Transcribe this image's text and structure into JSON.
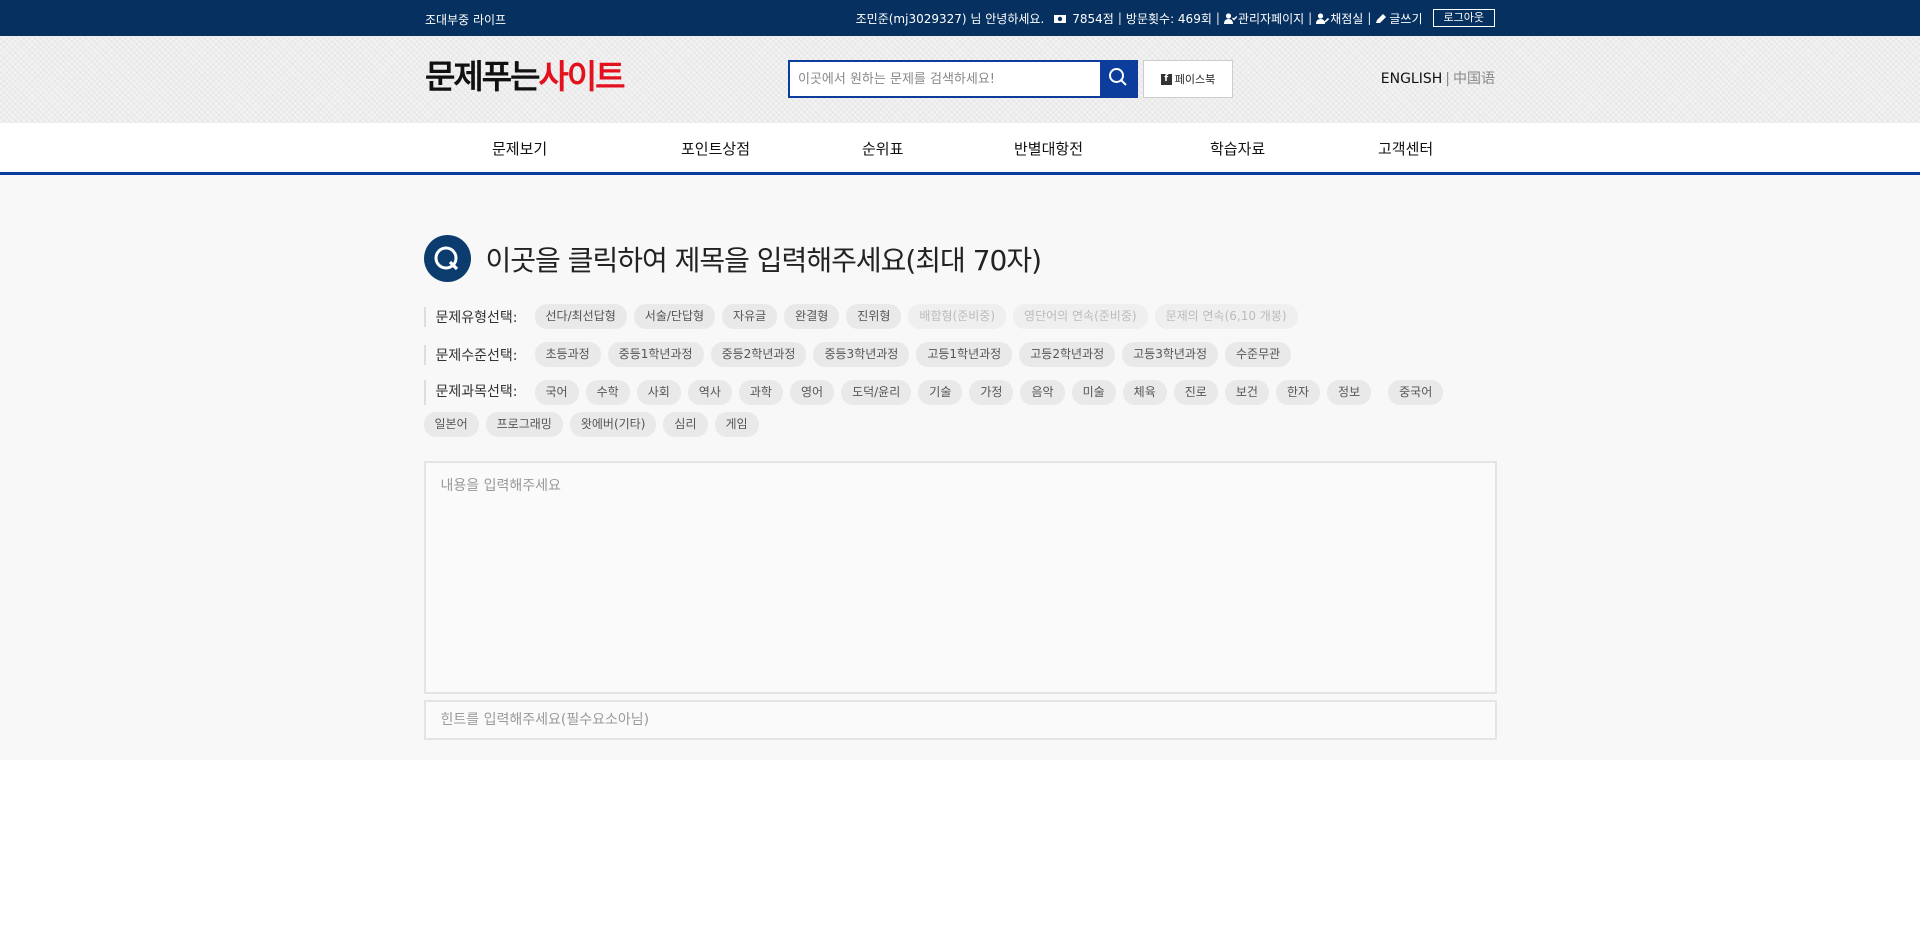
{
  "topbar": {
    "left_text": "조대부중 라이프",
    "greeting": "조민준(mj3029327) 님 안녕하세요.",
    "points": "7854점",
    "visits": "방문횟수: 469회",
    "admin": "관리자페이지",
    "grading": "채점실",
    "write": "글쓰기",
    "logout": "로그아웃",
    "separator": "|"
  },
  "header": {
    "logo_black": "문제푸는",
    "logo_red": "사이트",
    "search_placeholder": "이곳에서 원하는 문제를 검색하세요!",
    "facebook": "페이스북",
    "lang_en": "ENGLISH",
    "lang_cn": "中国语",
    "lang_separator": "|"
  },
  "nav": {
    "items": [
      "문제보기",
      "포인트상점",
      "순위표",
      "반별대항전",
      "학습자료",
      "고객센터"
    ]
  },
  "form": {
    "title_placeholder": "이곳을 클릭하여 제목을 입력해주세요(최대 70자)",
    "type_label": "문제유형선택:",
    "type_chips": [
      "선다/최선답형",
      "서술/단답형",
      "자유글",
      "완결형",
      "진위형",
      "배합형(준비중)",
      "영단어의 연속(준비중)",
      "문제의 연속(6,10 개봉)"
    ],
    "level_label": "문제수준선택:",
    "level_chips": [
      "초등과정",
      "중등1학년과정",
      "중등2학년과정",
      "중등3학년과정",
      "고등1학년과정",
      "고등2학년과정",
      "고등3학년과정",
      "수준무관"
    ],
    "subject_label": "문제과목선택:",
    "subject_chips": [
      "국어",
      "수학",
      "사회",
      "역사",
      "과학",
      "영어",
      "도덕/윤리",
      "기술",
      "가정",
      "음악",
      "미술",
      "체육",
      "진로",
      "보건",
      "한자",
      "정보",
      "중국어",
      "일본어",
      "프로그래밍",
      "왓에버(기타)",
      "심리",
      "게임"
    ],
    "content_placeholder": "내용을 입력해주세요",
    "hint_placeholder": "힌트를 입력해주세요(필수요소아님)"
  },
  "colors": {
    "topbar_bg": "#06305f",
    "accent_blue": "#0c3c9c",
    "logo_red": "#e3101e"
  },
  "icons": {
    "points": "money-icon",
    "admin": "user-check-icon",
    "grading": "user-edit-icon",
    "write": "pen-icon",
    "search": "search-icon",
    "facebook": "facebook-icon",
    "title": "q-badge-icon"
  }
}
